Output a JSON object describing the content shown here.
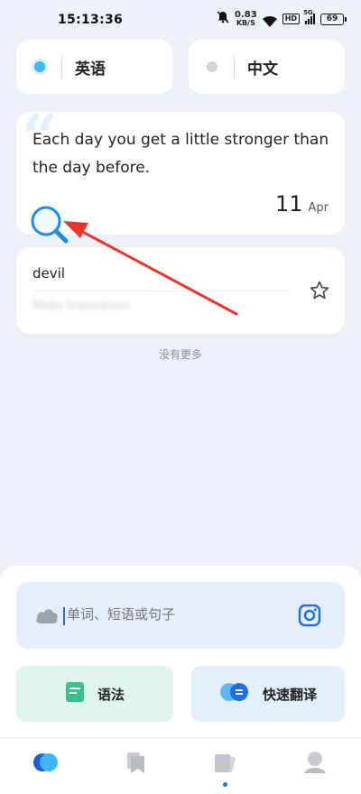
{
  "status_bar": {
    "time": "15:13:36",
    "net_speed_value": "0.83",
    "net_speed_unit": "KB/S",
    "hd": "HD",
    "signal_tag": "5G",
    "battery": "69"
  },
  "languages": {
    "source": "英语",
    "target": "中文"
  },
  "daily_quote": {
    "text": "Each day you get a little stronger than the day before.",
    "day": "11",
    "month": "Apr"
  },
  "word_entry": {
    "word": "devil",
    "translation_placeholder": "Make translation"
  },
  "list_end_text": "没有更多",
  "input": {
    "placeholder": "单词、短语或句子"
  },
  "actions": {
    "grammar": "语法",
    "quick_translate": "快速翻译"
  },
  "colors": {
    "accent": "#3db7ff",
    "annotation_arrow": "#e8382b",
    "tab_active": "#1f7ae0"
  },
  "icons": [
    "search-icon",
    "star-icon",
    "cloud-icon",
    "camera-icon",
    "book-icon",
    "toggle-icon",
    "home-icon",
    "bookmark-icon",
    "cards-icon",
    "profile-icon"
  ]
}
